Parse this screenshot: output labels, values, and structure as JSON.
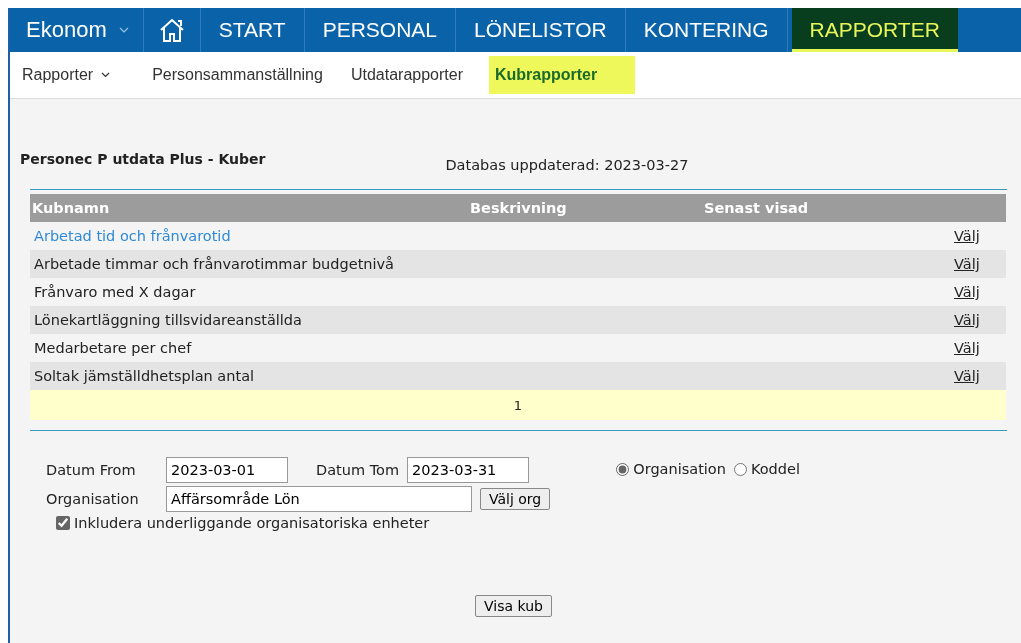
{
  "top_nav": {
    "app": "Ekonom",
    "items": [
      {
        "label": "START",
        "selected": false
      },
      {
        "label": "PERSONAL",
        "selected": false
      },
      {
        "label": "LÖNELISTOR",
        "selected": false
      },
      {
        "label": "KONTERING",
        "selected": false
      },
      {
        "label": "RAPPORTER",
        "selected": true
      }
    ]
  },
  "sub_nav": {
    "menu": "Rapporter",
    "items": [
      {
        "label": "Personsammanställning",
        "selected": false
      },
      {
        "label": "Utdatarapporter",
        "selected": false
      },
      {
        "label": "Kubrapporter",
        "selected": true
      }
    ]
  },
  "page_title": "Personec P utdata Plus - Kuber",
  "updated": "Databas uppdaterad: 2023-03-27",
  "table": {
    "columns": [
      "Kubnamn",
      "Beskrivning",
      "Senast visad"
    ],
    "rows": [
      {
        "name": "Arbetad tid och frånvarotid",
        "action": "Välj",
        "hovered": true
      },
      {
        "name": "Arbetade timmar och frånvarotimmar budgetnivå",
        "action": "Välj",
        "hovered": false
      },
      {
        "name": "Frånvaro med X dagar",
        "action": "Välj",
        "hovered": false
      },
      {
        "name": "Lönekartläggning tillsvidareanställda",
        "action": "Välj",
        "hovered": false
      },
      {
        "name": "Medarbetare per chef",
        "action": "Välj",
        "hovered": false
      },
      {
        "name": "Soltak jämställdhetsplan antal",
        "action": "Välj",
        "hovered": false
      }
    ],
    "pager": "1"
  },
  "form": {
    "date_from": {
      "label": "Datum From",
      "value": "2023-03-01"
    },
    "date_to": {
      "label": "Datum Tom",
      "value": "2023-03-31"
    },
    "organisation": {
      "label": "Organisation",
      "value": "Affärsområde Lön",
      "button": "Välj org"
    },
    "mode": [
      {
        "label": "Organisation",
        "selected": true
      },
      {
        "label": "Koddel",
        "selected": false
      }
    ],
    "include": {
      "label": "Inkludera underliggande organisatoriska enheter",
      "checked": true
    },
    "submit": "Visa kub"
  }
}
